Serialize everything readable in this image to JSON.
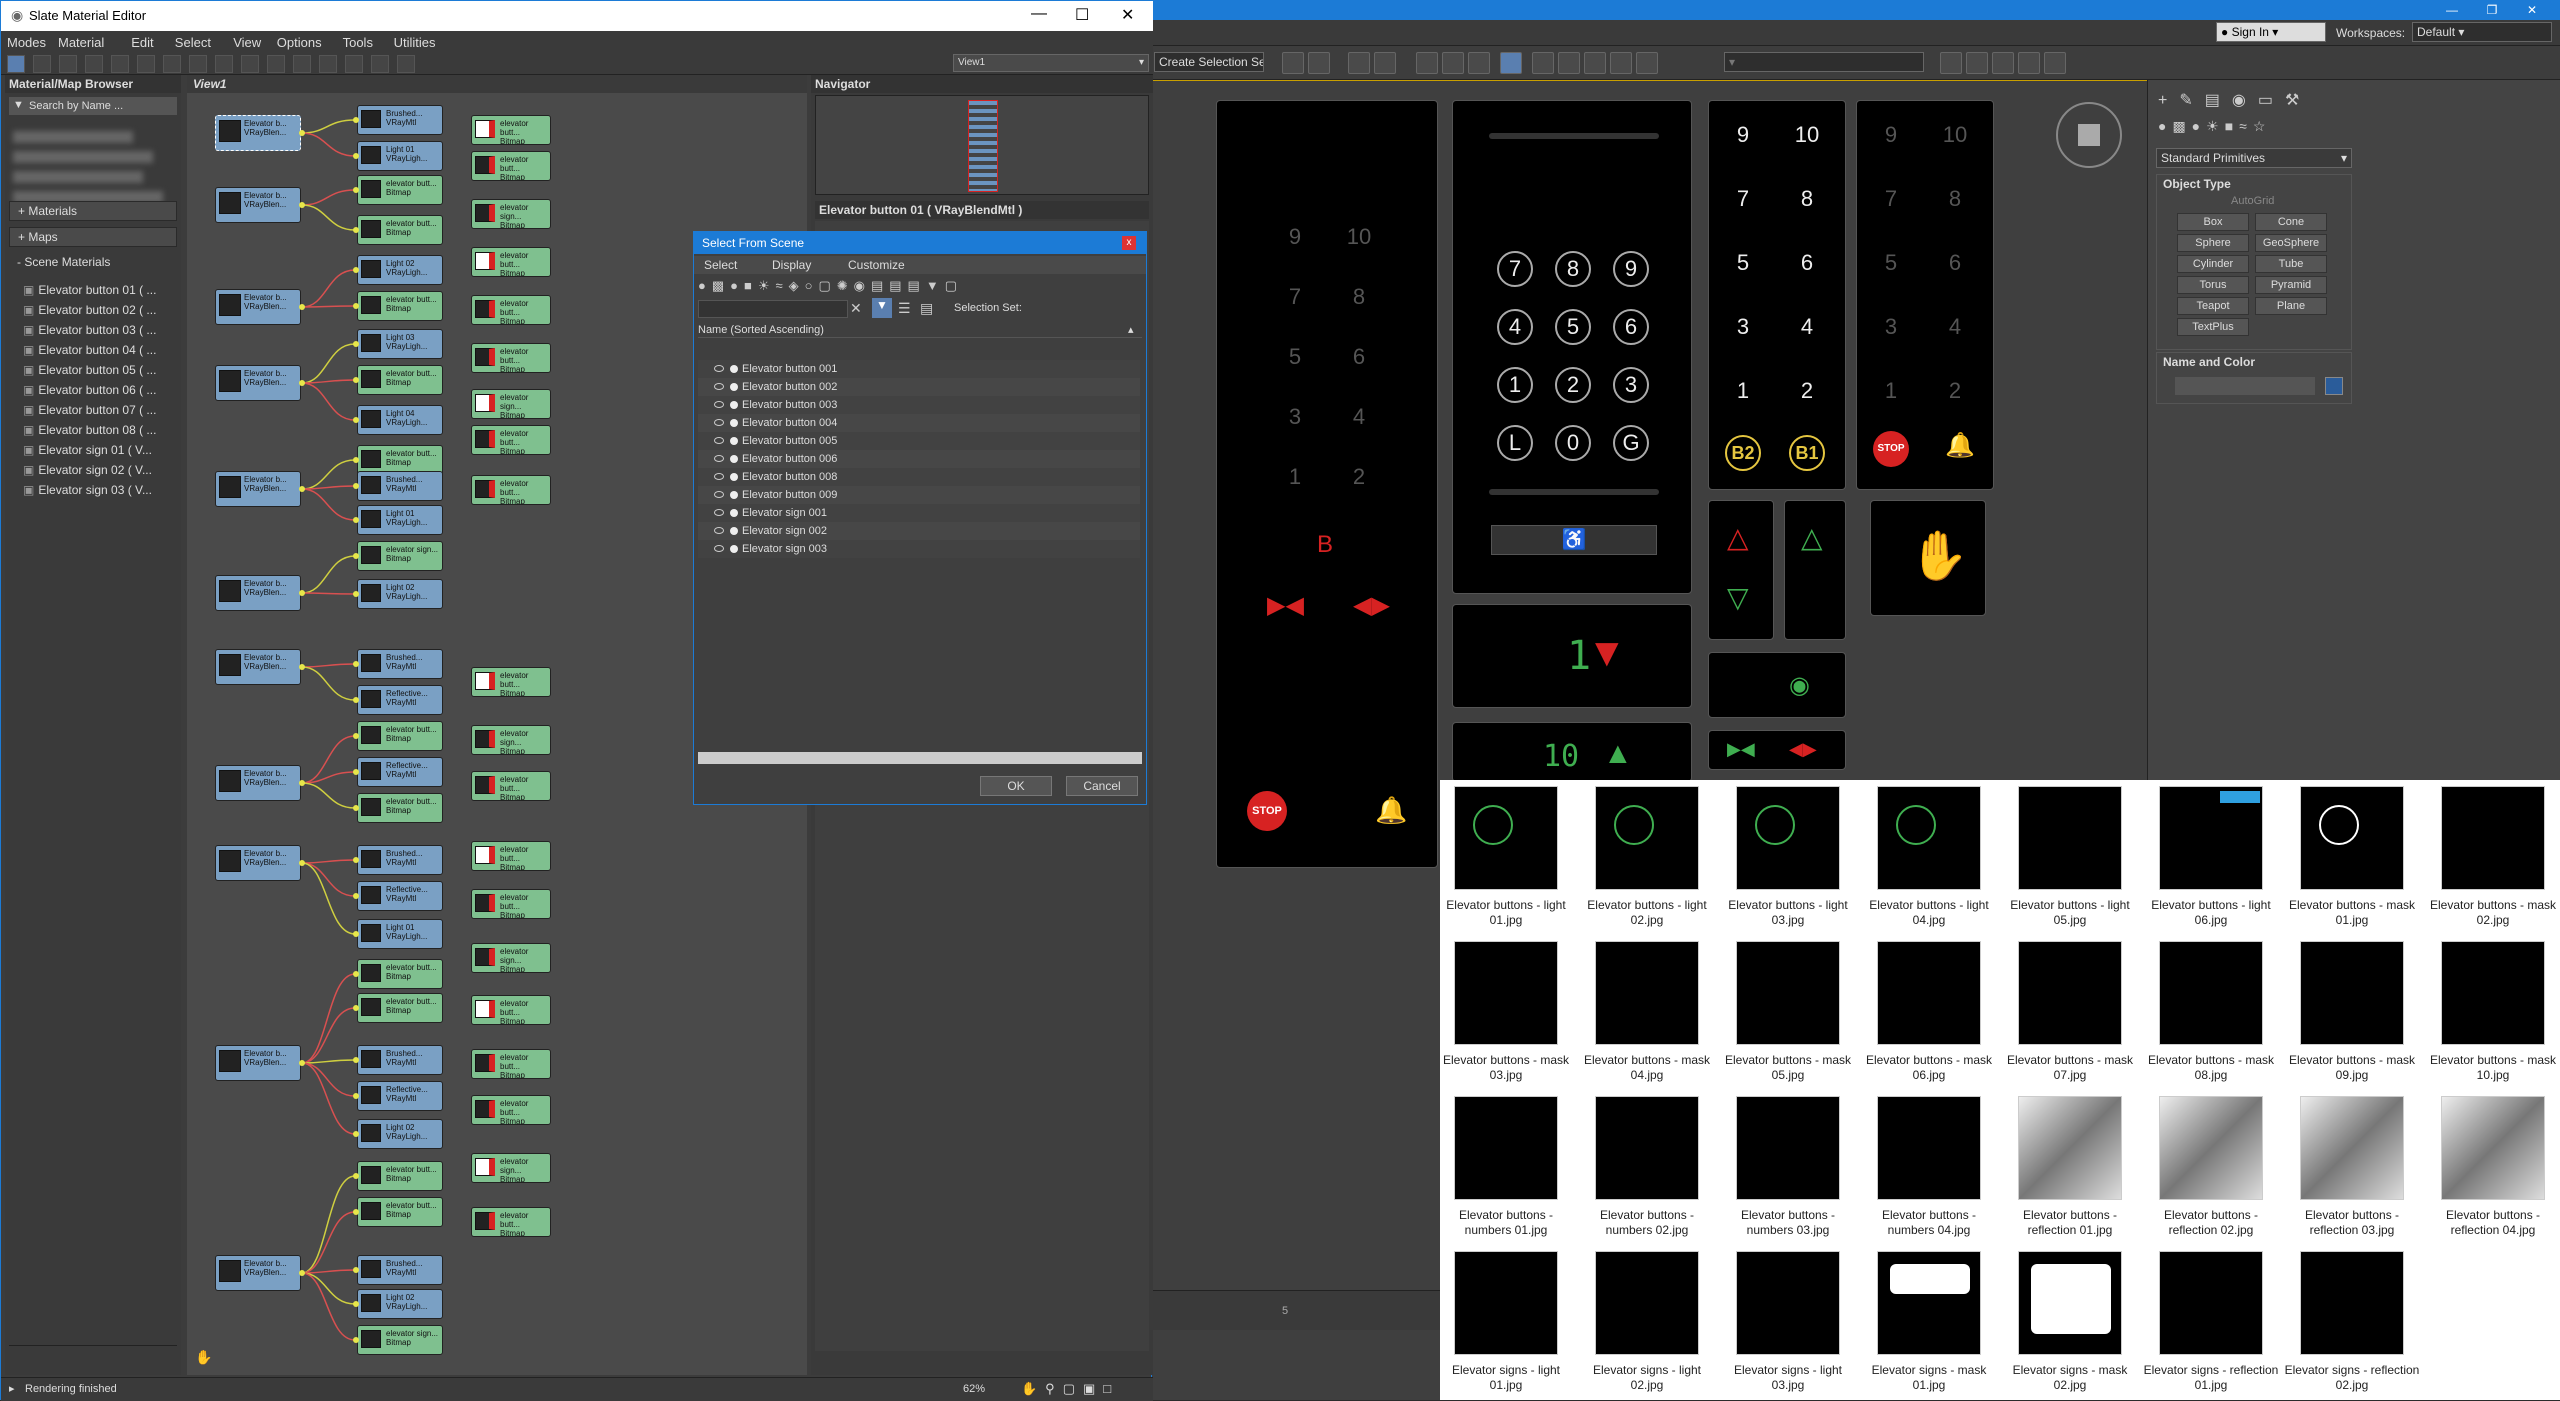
{
  "slate": {
    "title": "Slate Material Editor",
    "menu": [
      "Modes",
      "Material",
      "Edit",
      "Select",
      "View",
      "Options",
      "Tools",
      "Utilities"
    ],
    "view_dropdown": "View1",
    "browser_title": "Material/Map Browser",
    "search_placeholder": "Search by Name ...",
    "sections": {
      "materials": "+ Materials",
      "maps": "+ Maps",
      "scene": "- Scene Materials"
    },
    "scene_materials": [
      "Elevator button 01 ( ...",
      "Elevator button 02 ( ...",
      "Elevator button 03 ( ...",
      "Elevator button 04 ( ...",
      "Elevator button 05 ( ...",
      "Elevator button 06 ( ...",
      "Elevator button 07 ( ...",
      "Elevator button 08 ( ...",
      "Elevator sign 01 ( V...",
      "Elevator sign 02 ( V...",
      "Elevator sign 03 ( V..."
    ],
    "view_tab": "View1",
    "navigator_title": "Navigator",
    "param_title": "Elevator button 01  ( VRayBlendMtl )",
    "status": "Rendering finished",
    "zoom": "62%"
  },
  "nodes": {
    "blend_label": "Elevator b... VRayBlen...",
    "brushed": "Brushed... VRayMtl",
    "light01": "Light 01 VRayLigh...",
    "light02": "Light 02 VRayLigh...",
    "light03": "Light 03 VRayLigh...",
    "light04": "Light 04 VRayLigh...",
    "bitmap": "elevator butt... Bitmap",
    "reflective": "Reflective... VRayMtl",
    "sign_bitmap": "elevator sign... Bitmap"
  },
  "dialog": {
    "title": "Select From Scene",
    "close": "x",
    "menu": [
      "Select",
      "Display",
      "Customize"
    ],
    "selection_set_label": "Selection Set:",
    "column_header": "Name (Sorted Ascending)",
    "items": [
      "Elevator button 001",
      "Elevator button 002",
      "Elevator button 003",
      "Elevator button 004",
      "Elevator button 005",
      "Elevator button 006",
      "Elevator button 008",
      "Elevator button 009",
      "Elevator sign 001",
      "Elevator sign 002",
      "Elevator sign 003"
    ],
    "ok": "OK",
    "cancel": "Cancel"
  },
  "max": {
    "sign_in": "Sign In",
    "workspaces_label": "Workspaces:",
    "workspace": "Default",
    "selection_set_dropdown": "Create Selection Se",
    "create_panel": {
      "category": "Standard Primitives",
      "object_type_title": "Object Type",
      "autogrid": "AutoGrid",
      "buttons": [
        "Box",
        "Cone",
        "Sphere",
        "GeoSphere",
        "Cylinder",
        "Tube",
        "Torus",
        "Pyramid",
        "Teapot",
        "Plane",
        "TextPlus"
      ],
      "name_color_title": "Name and Color"
    },
    "timeline_tick": "5"
  },
  "viewport": {
    "keypad_center": [
      "7",
      "8",
      "9",
      "4",
      "5",
      "6",
      "1",
      "2",
      "3",
      "L",
      "0",
      "G"
    ],
    "keypad_right": [
      "9",
      "10",
      "7",
      "8",
      "5",
      "6",
      "3",
      "4",
      "1",
      "2"
    ],
    "keypad_right_bottom": [
      "B2",
      "B1"
    ],
    "keypad_left": [
      "9",
      "10",
      "7",
      "8",
      "5",
      "6",
      "3",
      "4",
      "1",
      "2"
    ],
    "left_b": "B",
    "stop": "STOP",
    "display_floor": "1",
    "display_bottom": "10"
  },
  "thumbnails": [
    "Elevator buttons - light 01.jpg",
    "Elevator buttons - light 02.jpg",
    "Elevator buttons - light 03.jpg",
    "Elevator buttons - light 04.jpg",
    "Elevator buttons - light 05.jpg",
    "Elevator buttons - light 06.jpg",
    "Elevator buttons - mask 01.jpg",
    "Elevator buttons - mask 02.jpg",
    "Elevator buttons - mask 03.jpg",
    "Elevator buttons - mask 04.jpg",
    "Elevator buttons - mask 05.jpg",
    "Elevator buttons - mask 06.jpg",
    "Elevator buttons - mask 07.jpg",
    "Elevator buttons - mask 08.jpg",
    "Elevator buttons - mask 09.jpg",
    "Elevator buttons - mask 10.jpg",
    "Elevator buttons - numbers 01.jpg",
    "Elevator buttons - numbers 02.jpg",
    "Elevator buttons - numbers 03.jpg",
    "Elevator buttons - numbers 04.jpg",
    "Elevator buttons - reflection 01.jpg",
    "Elevator buttons - reflection 02.jpg",
    "Elevator buttons - reflection 03.jpg",
    "Elevator buttons - reflection 04.jpg",
    "Elevator signs - light 01.jpg",
    "Elevator signs - light 02.jpg",
    "Elevator signs - light 03.jpg",
    "Elevator signs - mask 01.jpg",
    "Elevator signs - mask 02.jpg",
    "Elevator signs - reflection 01.jpg",
    "Elevator signs - reflection 02.jpg"
  ],
  "colors": {
    "accent": "#1c7bd6",
    "node_blue": "#7aa0c4",
    "node_green": "#7fc08f",
    "wire_red": "#d85050",
    "light_green": "#3fae50",
    "light_red": "#d72222"
  }
}
